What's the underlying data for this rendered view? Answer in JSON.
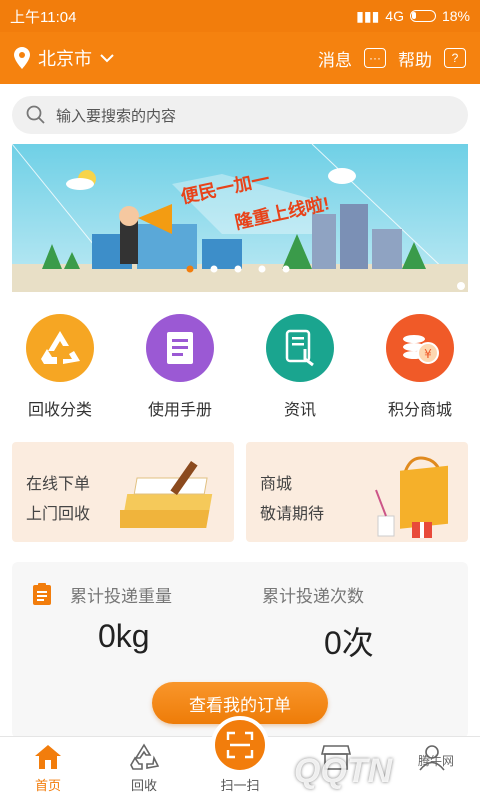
{
  "status_bar": {
    "time": "上午11:04",
    "network": "4G",
    "battery": "18%"
  },
  "header": {
    "city": "北京市",
    "messages_label": "消息",
    "help_label": "帮助"
  },
  "search": {
    "placeholder": "输入要搜索的内容"
  },
  "banner": {
    "headline_1": "便民一加一",
    "headline_2": "隆重上线啦!"
  },
  "quick_actions": [
    {
      "label": "回收分类",
      "icon": "recycle-icon",
      "color": "#f6a623"
    },
    {
      "label": "使用手册",
      "icon": "manual-icon",
      "color": "#9b59d4"
    },
    {
      "label": "资讯",
      "icon": "news-icon",
      "color": "#1aa58f"
    },
    {
      "label": "积分商城",
      "icon": "coins-icon",
      "color": "#f05a28"
    }
  ],
  "promos": {
    "online": {
      "line1": "在线下单",
      "line2": "上门回收"
    },
    "mall": {
      "line1": "商城",
      "line2": "敬请期待"
    }
  },
  "stats": {
    "weight_label": "累计投递重量",
    "weight_value": "0kg",
    "count_label": "累计投递次数",
    "count_value": "0次",
    "order_button": "查看我的订单"
  },
  "tabbar": [
    {
      "label": "首页",
      "icon": "home-icon",
      "active": true
    },
    {
      "label": "回收",
      "icon": "recycle-icon"
    },
    {
      "label": "扫一扫",
      "icon": "scan-icon"
    },
    {
      "label": "",
      "icon": "store-icon"
    },
    {
      "label": "",
      "icon": "user-icon"
    }
  ],
  "watermark": {
    "text": "QQTN",
    "sub": "腾牛网"
  },
  "colors": {
    "brand_orange": "#f27d0c"
  }
}
